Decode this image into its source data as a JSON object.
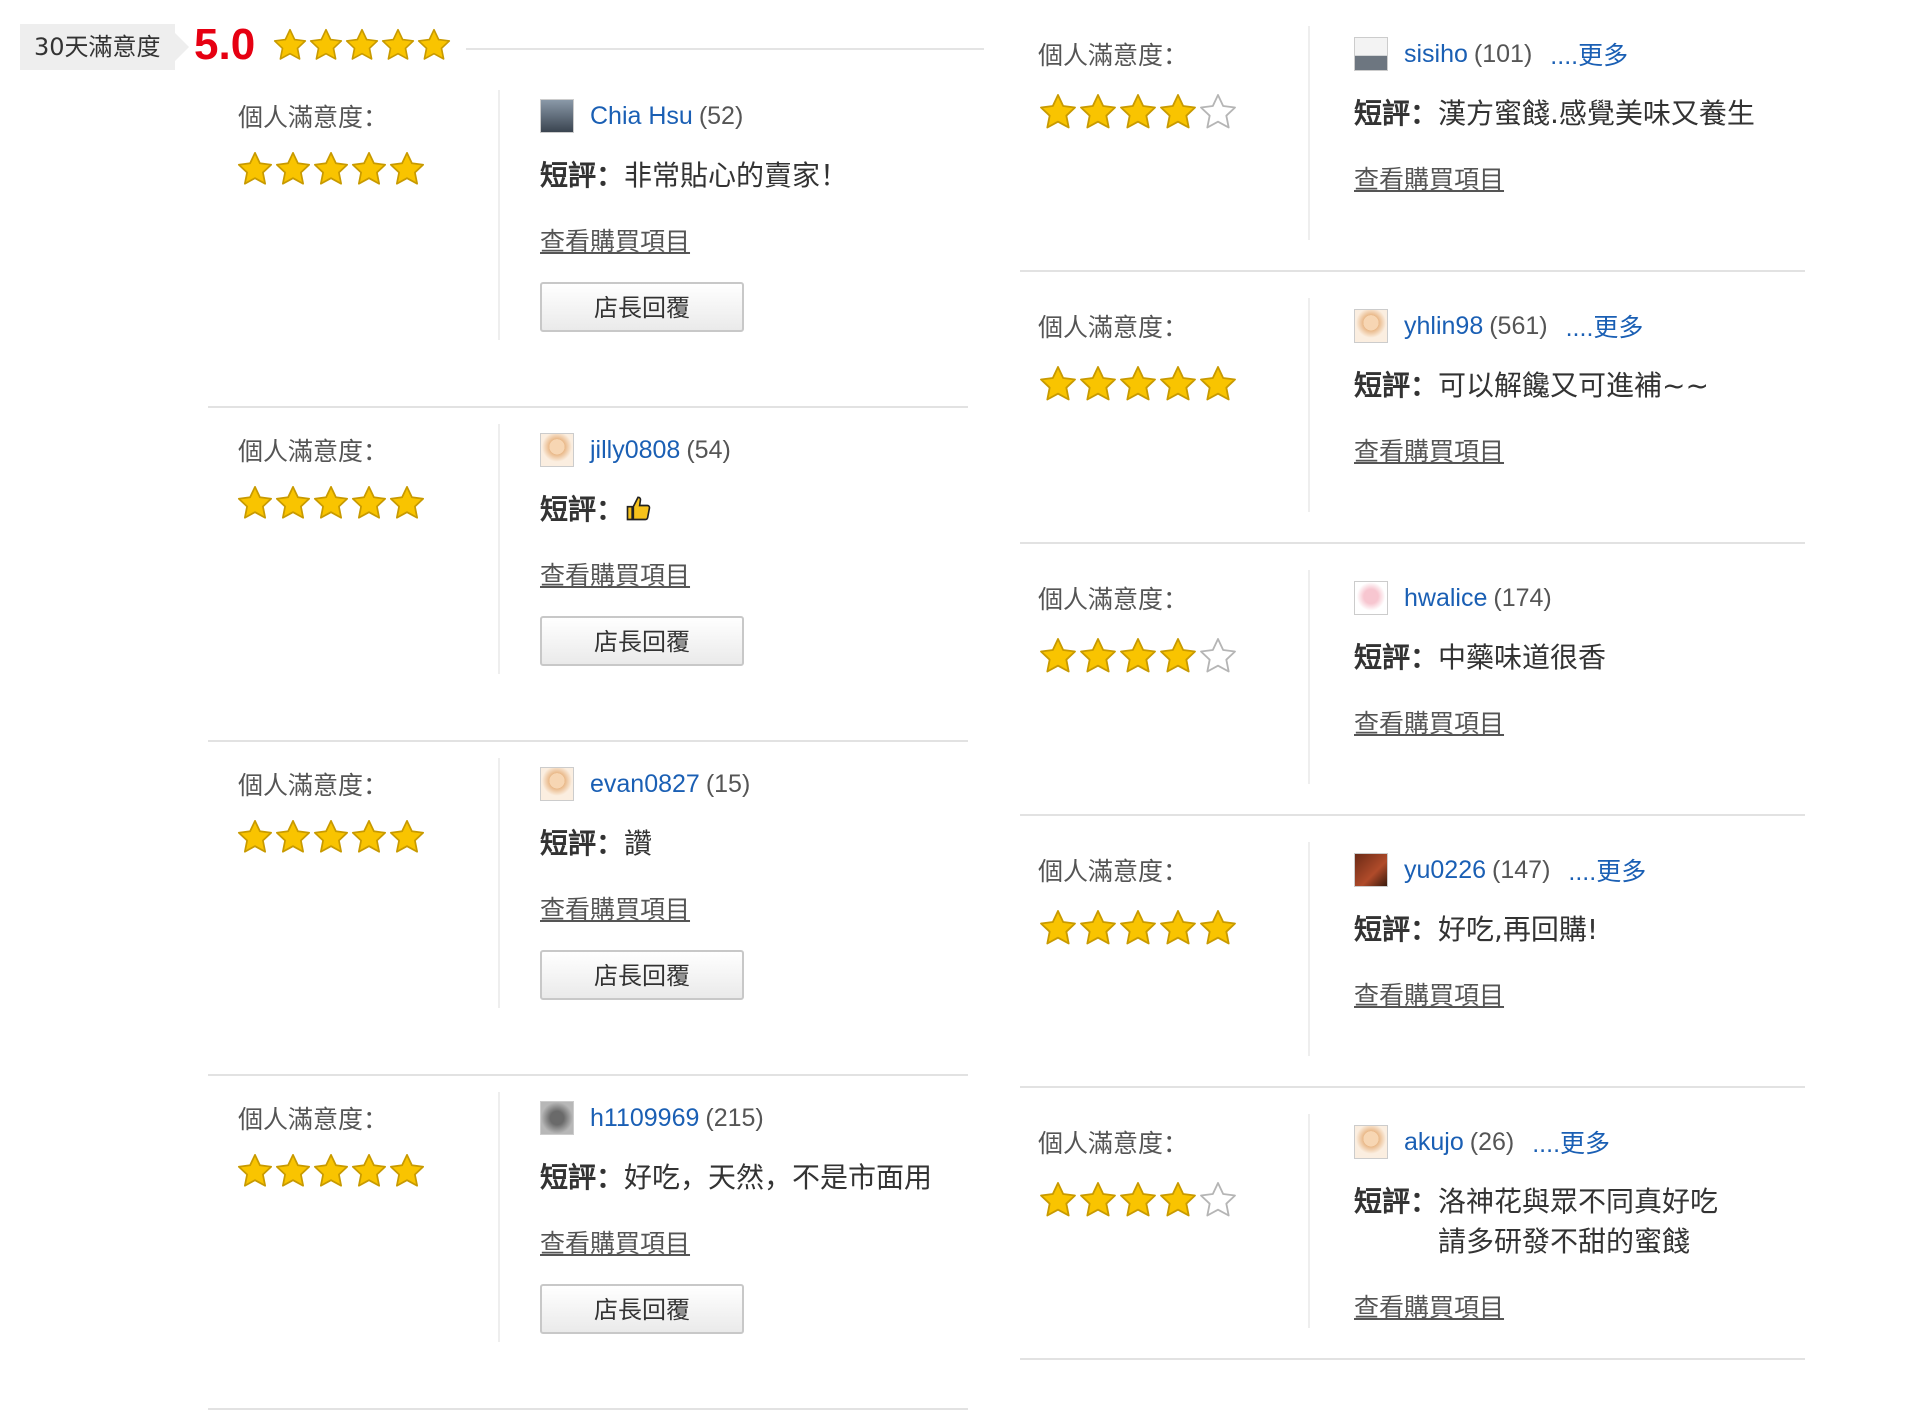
{
  "header": {
    "period_label": "30天滿意度",
    "score": "5.0",
    "rating": 5
  },
  "labels": {
    "satisfaction": "個人滿意度：",
    "comment_prefix": "短評：",
    "view_items": "查看購買項目",
    "reply": "店長回覆",
    "more": "....更多"
  },
  "left_reviews": [
    {
      "username": "Chia Hsu",
      "count": "(52)",
      "avatar": "dark",
      "rating": 5,
      "comment": "非常貼心的賣家！",
      "has_reply": true
    },
    {
      "username": "jilly0808",
      "count": "(54)",
      "avatar": "face",
      "rating": 5,
      "comment": "",
      "thumb": true,
      "has_reply": true
    },
    {
      "username": "evan0827",
      "count": "(15)",
      "avatar": "face",
      "rating": 5,
      "comment": "讚",
      "has_reply": true
    },
    {
      "username": "h1109969",
      "count": "(215)",
      "avatar": "mono",
      "rating": 5,
      "comment": "好吃，天然，不是市面用",
      "has_reply": true
    }
  ],
  "right_reviews": [
    {
      "username": "sisiho",
      "count": "(101)",
      "avatar": "sky",
      "rating": 4,
      "comment": "漢方蜜餞.感覺美味又養生",
      "more": true
    },
    {
      "username": "yhlin98",
      "count": "(561)",
      "avatar": "face",
      "rating": 5,
      "comment": "可以解饞又可進補~~",
      "more": true
    },
    {
      "username": "hwalice",
      "count": "(174)",
      "avatar": "pink",
      "rating": 4,
      "comment": "中藥味道很香",
      "more": false
    },
    {
      "username": "yu0226",
      "count": "(147)",
      "avatar": "brown",
      "rating": 5,
      "comment": "好吃,再回購!",
      "more": true
    },
    {
      "username": "akujo",
      "count": "(26)",
      "avatar": "face",
      "rating": 4,
      "comment": "洛神花與眾不同真好吃",
      "comment_line2": "請多研發不甜的蜜餞",
      "more": true
    }
  ],
  "colors": {
    "score": "#e60012",
    "link": "#1a5fb4",
    "star_fill": "#f9c400",
    "star_empty": "#ffffff"
  }
}
